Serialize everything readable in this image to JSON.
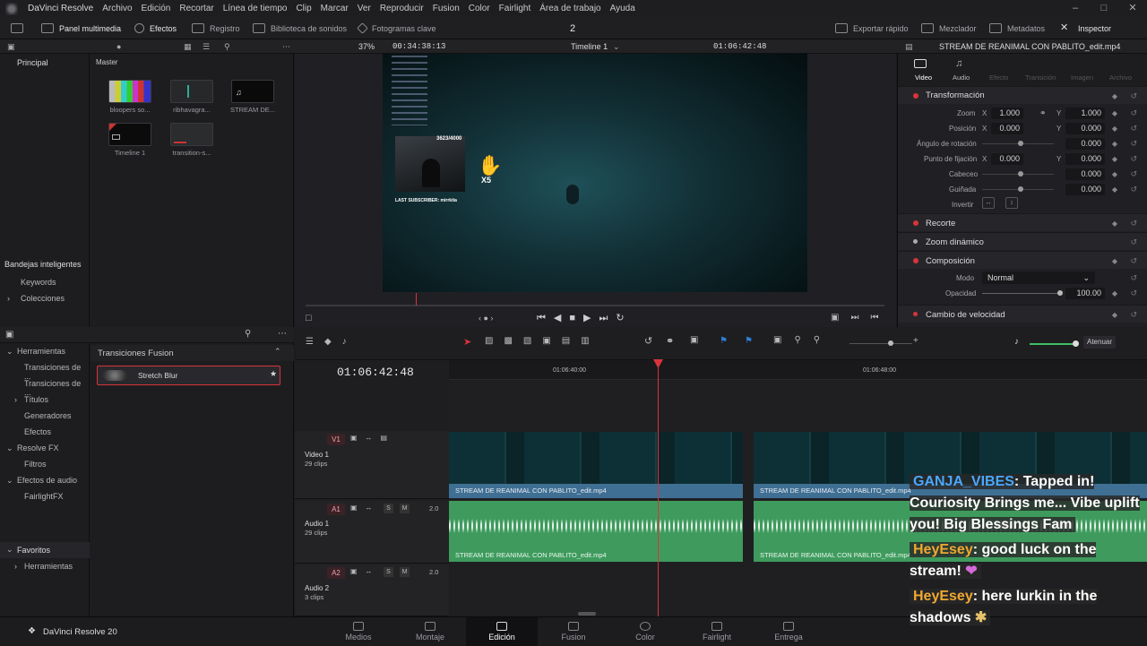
{
  "app": {
    "title": "DaVinci Resolve",
    "version_label": "DaVinci Resolve 20"
  },
  "menu": [
    "Archivo",
    "Edición",
    "Recortar",
    "Línea de tiempo",
    "Clip",
    "Marcar",
    "Ver",
    "Reproducir",
    "Fusion",
    "Color",
    "Fairlight",
    "Área de trabajo",
    "Ayuda"
  ],
  "toolbar": {
    "media_pool": "Panel multimedia",
    "effects": "Efectos",
    "edit_index": "Registro",
    "sound_library": "Biblioteca de sonidos",
    "keyframes": "Fotogramas clave",
    "center_number": "2",
    "quick_export": "Exportar rápido",
    "mixer": "Mezclador",
    "metadata": "Metadatos",
    "inspector": "Inspector"
  },
  "viewer_bar": {
    "zoom": "37%",
    "source_tc": "00:34:38:13",
    "timeline_name": "Timeline 1",
    "record_tc": "01:06:42:48",
    "clip_name": "STREAM DE REANIMAL CON PABLITO_edit.mp4"
  },
  "media_pool": {
    "left_header": "Principal",
    "right_header": "Master",
    "smart_bins": "Bandejas inteligentes",
    "keywords": "Keywords",
    "collections": "Colecciones",
    "clips": [
      {
        "name": "bloopers so..."
      },
      {
        "name": "ribhavagra..."
      },
      {
        "name": "STREAM DE..."
      },
      {
        "name": "Timeline 1"
      },
      {
        "name": "transition-s..."
      }
    ]
  },
  "effects_library": {
    "tree": [
      {
        "label": "Herramientas",
        "level": 0,
        "open": true
      },
      {
        "label": "Transiciones de ...",
        "level": 1
      },
      {
        "label": "Transiciones de ...",
        "level": 1
      },
      {
        "label": "Títulos",
        "level": 1,
        "collapsed": true
      },
      {
        "label": "Generadores",
        "level": 1
      },
      {
        "label": "Efectos",
        "level": 1
      },
      {
        "label": "Resolve FX",
        "level": 0
      },
      {
        "label": "Filtros",
        "level": 1
      },
      {
        "label": "Efectos de audio",
        "level": 0
      },
      {
        "label": "FairlightFX",
        "level": 1
      }
    ],
    "favorites": "Favoritos",
    "favorites_child": "Herramientas",
    "section_title": "Transiciones Fusion",
    "selected_item": "Stretch Blur"
  },
  "inspector": {
    "tabs": [
      "Video",
      "Audio",
      "Efecto",
      "Transición",
      "Imagen",
      "Archivo"
    ],
    "transform_title": "Transformación",
    "zoom_label": "Zoom",
    "zoom_x": "1.000",
    "zoom_y": "1.000",
    "position_label": "Posición",
    "pos_x": "0.000",
    "pos_y": "0.000",
    "rotation_label": "Ángulo de rotación",
    "rotation": "0.000",
    "anchor_label": "Punto de fijación",
    "anchor_x": "0.000",
    "anchor_y": "0.000",
    "pitch_label": "Cabeceo",
    "pitch": "0.000",
    "yaw_label": "Guiñada",
    "yaw": "0.000",
    "flip_label": "Invertir",
    "crop_title": "Recorte",
    "dynamic_zoom_title": "Zoom dinámico",
    "composite_title": "Composición",
    "mode_label": "Modo",
    "mode_value": "Normal",
    "opacity_label": "Opacidad",
    "opacity": "100.00",
    "speed_title": "Cambio de velocidad",
    "axis_x": "X",
    "axis_y": "Y"
  },
  "overlay_text": {
    "goal": "3623/4000",
    "multiplier": "X5",
    "last_sub": "LAST SUBSCRIBER: mirrkita"
  },
  "timeline": {
    "timecode": "01:06:42:48",
    "ruler": [
      "01:06:40:00",
      "01:06:48:00"
    ],
    "attenuate": "Atenuar",
    "tracks": [
      {
        "tag": "V1",
        "name": "Video 1",
        "count": "29 clips"
      },
      {
        "tag": "A1",
        "name": "Audio 1",
        "count": "29 clips",
        "level": "2.0"
      },
      {
        "tag": "A2",
        "name": "Audio 2",
        "count": "3 clips",
        "level": "2.0"
      }
    ],
    "clip_label": "STREAM DE REANIMAL CON PABLITO_edit.mp4",
    "solo": "S",
    "mute": "M"
  },
  "chat": [
    {
      "user": "GANJA_VIBES",
      "user_color": "#4aa8ff",
      "text": ": Tapped in! Couriosity Brings me... Vibe uplift you! Big Blessings Fam"
    },
    {
      "user": "HeyEsey",
      "user_color": "#f0a830",
      "text": ": good luck on the stream!"
    },
    {
      "user": "HeyEsey",
      "user_color": "#f0a830",
      "text": ": here lurkin in the shadows"
    }
  ],
  "pages": [
    "Medios",
    "Montaje",
    "Edición",
    "Fusion",
    "Color",
    "Fairlight",
    "Entrega"
  ],
  "active_page": "Edición",
  "colors": {
    "accent_red": "#d8343a",
    "video_clip": "#3f6f93",
    "audio_clip": "#3e9b5d",
    "playhead": "#d8343a"
  }
}
